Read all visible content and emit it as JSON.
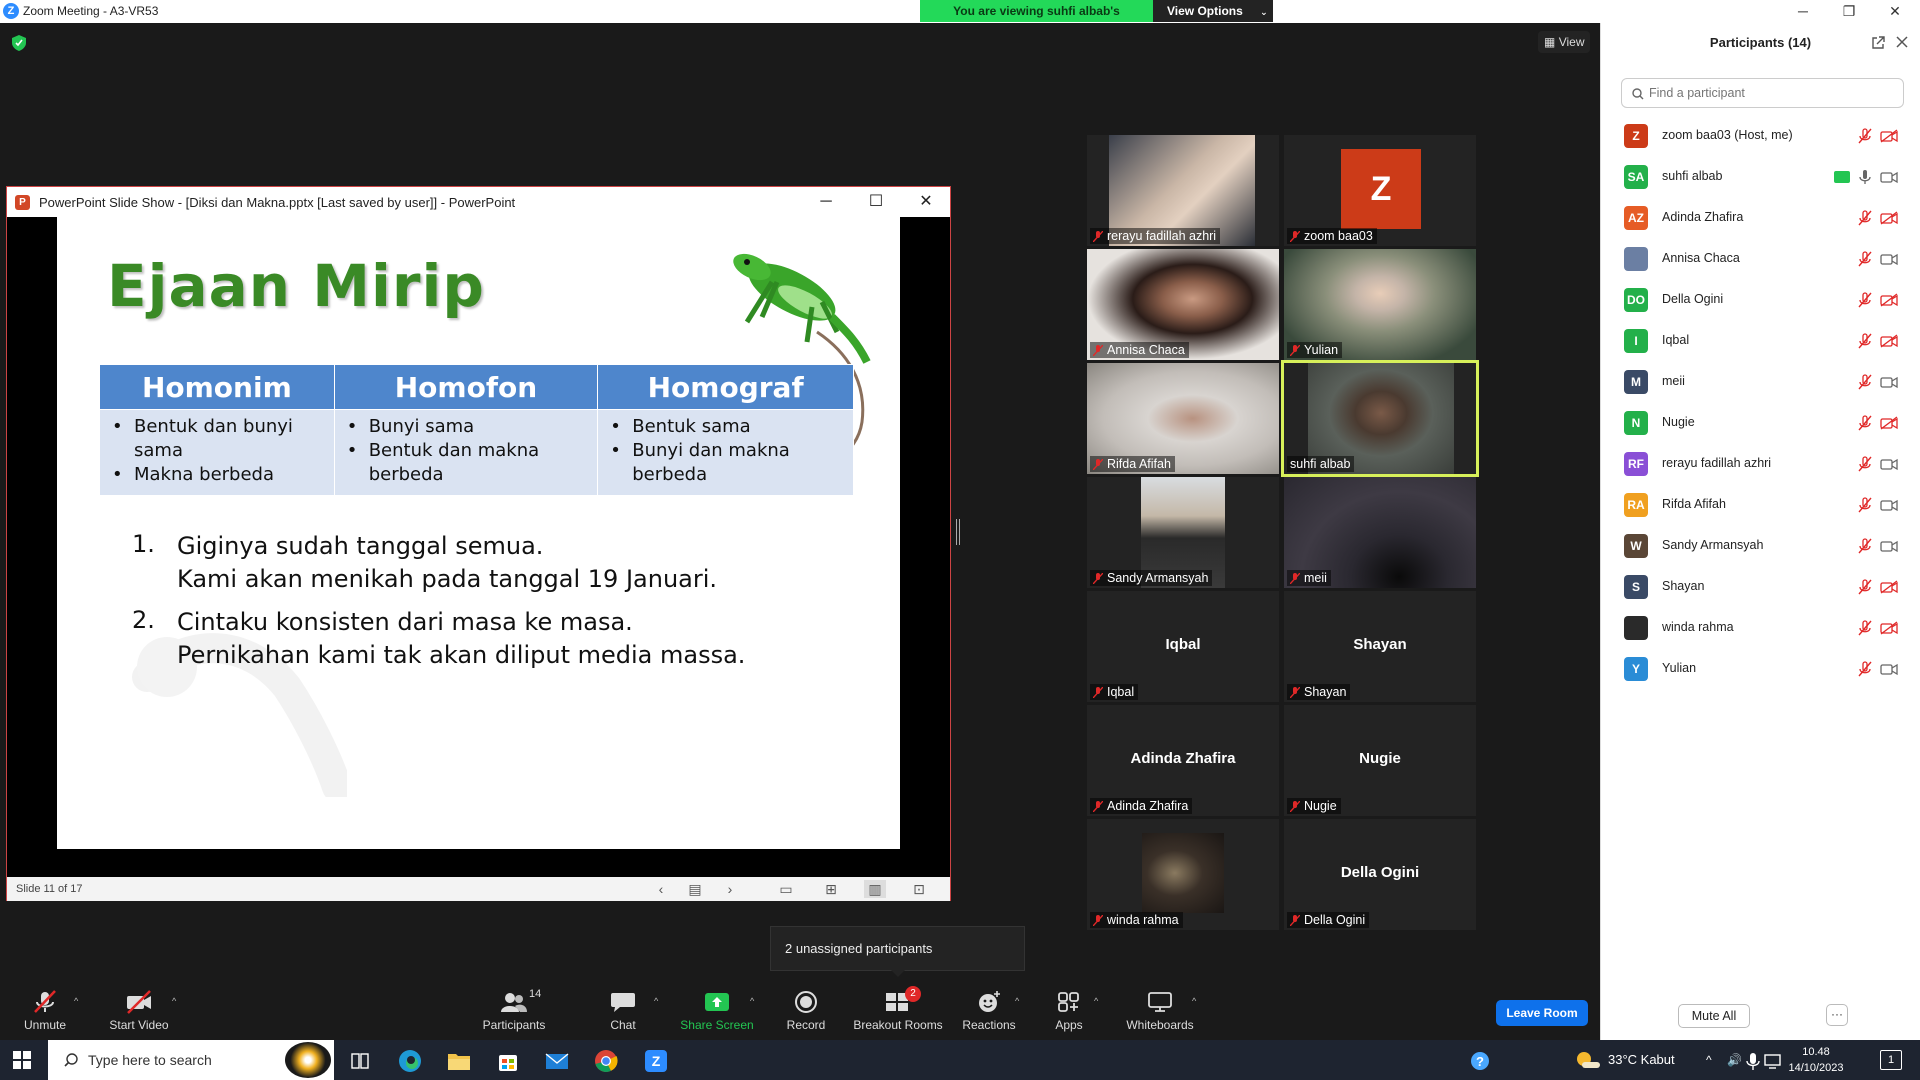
{
  "window": {
    "title": "Zoom Meeting - A3-VR53",
    "minimize": "─",
    "restore": "❐",
    "close": "✕"
  },
  "banner": {
    "message": "You are viewing suhfi albab's screen",
    "view_options": "View Options"
  },
  "view_button": "View",
  "powerpoint": {
    "title": "PowerPoint Slide Show - [Diksi dan Makna.pptx [Last saved by user]] - PowerPoint",
    "minimize": "─",
    "maximize": "☐",
    "close": "✕",
    "status": "Slide 11 of 17",
    "slide": {
      "title": "Ejaan Mirip",
      "table_headers": [
        "Homonim",
        "Homofon",
        "Homograf"
      ],
      "table_cells": [
        [
          "Bentuk dan bunyi sama",
          "Makna berbeda"
        ],
        [
          "Bunyi sama",
          "Bentuk dan makna berbeda"
        ],
        [
          "Bentuk sama",
          "Bunyi dan makna berbeda"
        ]
      ],
      "list": [
        {
          "num": "1.",
          "line1": "Giginya sudah tanggal semua.",
          "line2": "Kami akan menikah pada tanggal 19 Januari."
        },
        {
          "num": "2.",
          "line1": "Cintaku konsisten dari masa ke masa.",
          "line2": "Pernikahan kami tak akan diliput media massa."
        }
      ]
    }
  },
  "tiles": [
    {
      "name": "rerayu fadillah azhri"
    },
    {
      "name": "zoom baa03",
      "initial": "Z"
    },
    {
      "name": "Annisa Chaca"
    },
    {
      "name": "Yulian"
    },
    {
      "name": "Rifda Afifah"
    },
    {
      "name": "suhfi albab"
    },
    {
      "name": "Sandy Armansyah"
    },
    {
      "name": "meii"
    },
    {
      "name": "Iqbal",
      "center": "Iqbal"
    },
    {
      "name": "Shayan",
      "center": "Shayan"
    },
    {
      "name": "Adinda Zhafira",
      "center": "Adinda Zhafira"
    },
    {
      "name": "Nugie",
      "center": "Nugie"
    },
    {
      "name": "winda rahma"
    },
    {
      "name": "Della Ogini",
      "center": "Della Ogini"
    }
  ],
  "unassigned": "2 unassigned participants",
  "toolbar": {
    "unmute": "Unmute",
    "start_video": "Start Video",
    "participants": "Participants",
    "participants_count": "14",
    "chat": "Chat",
    "share_screen": "Share Screen",
    "record": "Record",
    "breakout_rooms": "Breakout Rooms",
    "breakout_badge": "2",
    "reactions": "Reactions",
    "apps": "Apps",
    "whiteboards": "Whiteboards",
    "leave_room": "Leave Room"
  },
  "panel": {
    "title": "Participants (14)",
    "search_placeholder": "Find a participant",
    "participants": [
      {
        "initials": "Z",
        "name": "zoom baa03 (Host, me)",
        "color": "#cc3b18"
      },
      {
        "initials": "SA",
        "name": "suhfi albab",
        "color": "#23b04a"
      },
      {
        "initials": "AZ",
        "name": "Adinda Zhafira",
        "color": "#e65c25"
      },
      {
        "initials": "",
        "name": "Annisa Chaca",
        "color": "#6b7fa3"
      },
      {
        "initials": "DO",
        "name": "Della Ogini",
        "color": "#23b04a"
      },
      {
        "initials": "I",
        "name": "Iqbal",
        "color": "#23b04a"
      },
      {
        "initials": "M",
        "name": "meii",
        "color": "#3a4a66"
      },
      {
        "initials": "N",
        "name": "Nugie",
        "color": "#23b04a"
      },
      {
        "initials": "RF",
        "name": "rerayu fadillah azhri",
        "color": "#8a4fd6"
      },
      {
        "initials": "RA",
        "name": "Rifda Afifah",
        "color": "#f0a020"
      },
      {
        "initials": "W",
        "name": "Sandy Armansyah",
        "color": "#5a4636"
      },
      {
        "initials": "S",
        "name": "Shayan",
        "color": "#3a4a66"
      },
      {
        "initials": "",
        "name": "winda rahma",
        "color": "#2a2a2a"
      },
      {
        "initials": "Y",
        "name": "Yulian",
        "color": "#2a8cd6"
      }
    ],
    "mute_all": "Mute All",
    "more": "···"
  },
  "taskbar": {
    "search_text": "Type here to search",
    "weather": "33°C  Kabut",
    "time": "10.48",
    "date": "14/10/2023",
    "notifications": "1"
  }
}
